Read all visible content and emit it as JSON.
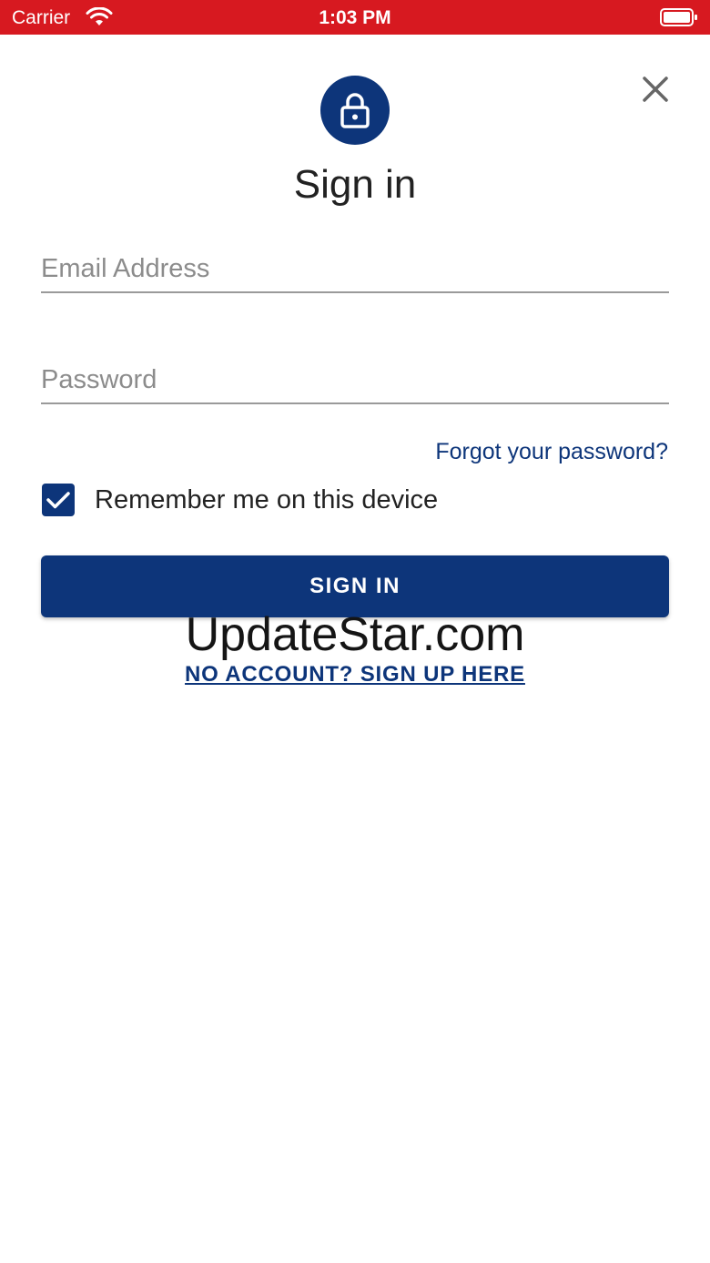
{
  "status_bar": {
    "carrier": "Carrier",
    "time": "1:03 PM"
  },
  "colors": {
    "status_bar": "#d71920",
    "primary": "#0d357a"
  },
  "icons": {
    "wifi": "wifi-icon",
    "battery": "battery-icon",
    "close": "close-icon",
    "lock": "lock-icon",
    "checkmark": "checkmark-icon"
  },
  "title": "Sign in",
  "email": {
    "placeholder": "Email Address",
    "value": ""
  },
  "password": {
    "placeholder": "Password",
    "value": ""
  },
  "forgot_password": "Forgot your password?",
  "remember": {
    "label": "Remember me on this device",
    "checked": true
  },
  "sign_in_button": "SIGN IN",
  "watermark": "UpdateStar.com",
  "sign_up_link": "NO ACCOUNT? SIGN UP HERE"
}
